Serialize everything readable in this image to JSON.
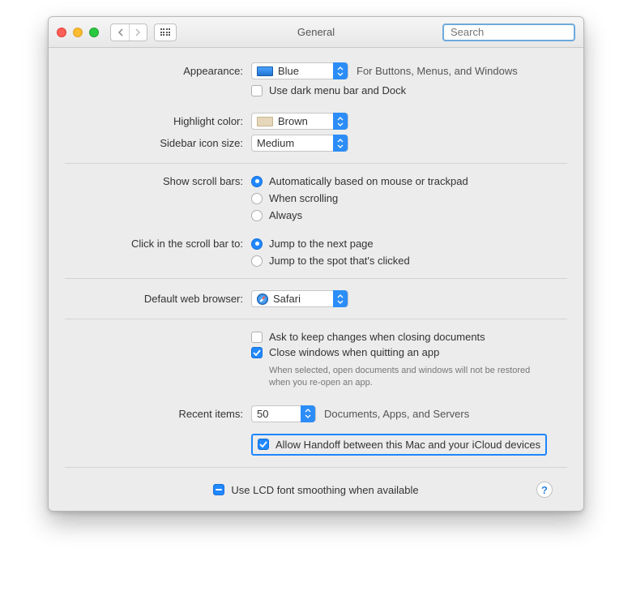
{
  "window": {
    "title": "General"
  },
  "search": {
    "placeholder": "Search"
  },
  "appearance": {
    "label": "Appearance:",
    "value": "Blue",
    "hint": "For Buttons, Menus, and Windows",
    "dark_mode_label": "Use dark menu bar and Dock",
    "dark_mode_checked": false
  },
  "highlight": {
    "label": "Highlight color:",
    "value": "Brown"
  },
  "sidebar_icon": {
    "label": "Sidebar icon size:",
    "value": "Medium"
  },
  "scrollbars": {
    "label": "Show scroll bars:",
    "options": {
      "auto": "Automatically based on mouse or trackpad",
      "scrolling": "When scrolling",
      "always": "Always"
    },
    "selected": "auto"
  },
  "click_scroll": {
    "label": "Click in the scroll bar to:",
    "options": {
      "next": "Jump to the next page",
      "spot": "Jump to the spot that's clicked"
    },
    "selected": "next"
  },
  "browser": {
    "label": "Default web browser:",
    "value": "Safari"
  },
  "documents": {
    "ask_label": "Ask to keep changes when closing documents",
    "ask_checked": false,
    "close_label": "Close windows when quitting an app",
    "close_checked": true,
    "close_hint": "When selected, open documents and windows will not be restored when you re-open an app."
  },
  "recent": {
    "label": "Recent items:",
    "value": "50",
    "hint": "Documents, Apps, and Servers"
  },
  "handoff": {
    "label": "Allow Handoff between this Mac and your iCloud devices",
    "checked": true
  },
  "lcd": {
    "label": "Use LCD font smoothing when available",
    "state": "mixed"
  },
  "help": "?"
}
